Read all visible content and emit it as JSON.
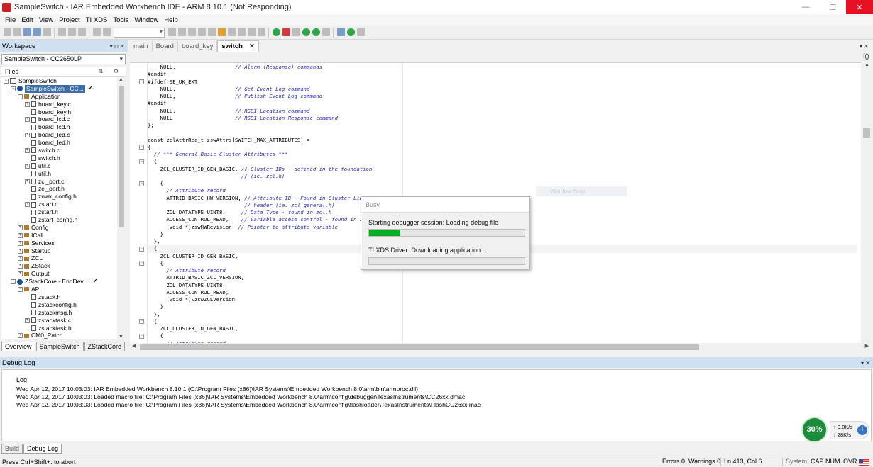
{
  "window": {
    "title": "SampleSwitch - IAR Embedded Workbench IDE - ARM 8.10.1 (Not Responding)",
    "minimize": "—",
    "maximize": "☐",
    "close": "✕"
  },
  "menu": [
    "File",
    "Edit",
    "View",
    "Project",
    "TI XDS",
    "Tools",
    "Window",
    "Help"
  ],
  "workspace": {
    "title": "Workspace",
    "controls": "▾ ⊓ ✕",
    "configuration": "SampleSwitch - CC2650LP",
    "files_label": "Files",
    "tree": [
      {
        "label": "SampleSwitch",
        "indent": 0,
        "exp": "⊟",
        "icon": "ws"
      },
      {
        "label": "SampleSwitch - CC...",
        "indent": 1,
        "exp": "⊟",
        "icon": "proj",
        "selected": true,
        "check": "✔"
      },
      {
        "label": "Application",
        "indent": 2,
        "exp": "⊟",
        "icon": "folder"
      },
      {
        "label": "board_key.c",
        "indent": 3,
        "exp": "⊞",
        "icon": "file"
      },
      {
        "label": "board_key.h",
        "indent": 3,
        "exp": "",
        "icon": "file"
      },
      {
        "label": "board_lcd.c",
        "indent": 3,
        "exp": "⊞",
        "icon": "file"
      },
      {
        "label": "board_lcd.h",
        "indent": 3,
        "exp": "",
        "icon": "file"
      },
      {
        "label": "board_led.c",
        "indent": 3,
        "exp": "⊞",
        "icon": "file"
      },
      {
        "label": "board_led.h",
        "indent": 3,
        "exp": "",
        "icon": "file"
      },
      {
        "label": "switch.c",
        "indent": 3,
        "exp": "⊞",
        "icon": "file"
      },
      {
        "label": "switch.h",
        "indent": 3,
        "exp": "",
        "icon": "file"
      },
      {
        "label": "util.c",
        "indent": 3,
        "exp": "⊞",
        "icon": "file"
      },
      {
        "label": "util.h",
        "indent": 3,
        "exp": "",
        "icon": "file"
      },
      {
        "label": "zcl_port.c",
        "indent": 3,
        "exp": "⊞",
        "icon": "file"
      },
      {
        "label": "zcl_port.h",
        "indent": 3,
        "exp": "",
        "icon": "file"
      },
      {
        "label": "znwk_config.h",
        "indent": 3,
        "exp": "",
        "icon": "file"
      },
      {
        "label": "zstart.c",
        "indent": 3,
        "exp": "⊞",
        "icon": "file"
      },
      {
        "label": "zstart.h",
        "indent": 3,
        "exp": "",
        "icon": "file"
      },
      {
        "label": "zstart_config.h",
        "indent": 3,
        "exp": "",
        "icon": "file"
      },
      {
        "label": "Config",
        "indent": 2,
        "exp": "⊞",
        "icon": "folder"
      },
      {
        "label": "ICall",
        "indent": 2,
        "exp": "⊞",
        "icon": "folder"
      },
      {
        "label": "Services",
        "indent": 2,
        "exp": "⊞",
        "icon": "folder"
      },
      {
        "label": "Startup",
        "indent": 2,
        "exp": "⊞",
        "icon": "folder"
      },
      {
        "label": "ZCL",
        "indent": 2,
        "exp": "⊞",
        "icon": "folder"
      },
      {
        "label": "ZStack",
        "indent": 2,
        "exp": "⊞",
        "icon": "folder"
      },
      {
        "label": "Output",
        "indent": 2,
        "exp": "⊞",
        "icon": "folder"
      },
      {
        "label": "ZStackCore - EndDevi...",
        "indent": 1,
        "exp": "⊟",
        "icon": "proj",
        "check": "✔"
      },
      {
        "label": "API",
        "indent": 2,
        "exp": "⊟",
        "icon": "folder"
      },
      {
        "label": "zstack.h",
        "indent": 3,
        "exp": "",
        "icon": "file"
      },
      {
        "label": "zstackconfig.h",
        "indent": 3,
        "exp": "",
        "icon": "file"
      },
      {
        "label": "zstackmsg.h",
        "indent": 3,
        "exp": "",
        "icon": "file"
      },
      {
        "label": "zstacktask.c",
        "indent": 3,
        "exp": "⊞",
        "icon": "file"
      },
      {
        "label": "zstacktask.h",
        "indent": 3,
        "exp": "",
        "icon": "file"
      },
      {
        "label": "CM0_Patch",
        "indent": 2,
        "exp": "⊞",
        "icon": "folder"
      }
    ],
    "tabs": [
      "Overview",
      "SampleSwitch",
      "ZStackCore"
    ]
  },
  "editor": {
    "tabs": [
      "main",
      "Board",
      "board_key",
      "switch"
    ],
    "active_tab": "switch",
    "tab_close": "✕",
    "controls": "▾ ✕",
    "function_button": "f()",
    "lines": [
      {
        "code": "    NULL,                   ",
        "comment": "// Alarm (Response) commands"
      },
      {
        "code": "#endif",
        "comment": ""
      },
      {
        "code": "#ifdef SE_UK_EXT",
        "comment": ""
      },
      {
        "code": "    NULL,                   ",
        "comment": "// Get Event Log command"
      },
      {
        "code": "    NULL,                   ",
        "comment": "// Publish Event Log command"
      },
      {
        "code": "#endif",
        "comment": ""
      },
      {
        "code": "    NULL,                   ",
        "comment": "// RSSI Location command"
      },
      {
        "code": "    NULL                    ",
        "comment": "// RSSI Location Response command"
      },
      {
        "code": "};",
        "comment": ""
      },
      {
        "code": "",
        "comment": ""
      },
      {
        "code": "const zclAttrRec_t zswAttrs[SWITCH_MAX_ATTRIBUTES] =",
        "comment": ""
      },
      {
        "code": "{",
        "comment": ""
      },
      {
        "code": "  ",
        "comment": "// *** General Basic Cluster Attributes ***"
      },
      {
        "code": "  {",
        "comment": ""
      },
      {
        "code": "    ZCL_CLUSTER_ID_GEN_BASIC, ",
        "comment": "// Cluster IDs - defined in the foundation"
      },
      {
        "code": "                              ",
        "comment": "// (ie. zcl.h)"
      },
      {
        "code": "    {",
        "comment": ""
      },
      {
        "code": "      ",
        "comment": "// Attribute record"
      },
      {
        "code": "      ATTRID_BASIC_HW_VERSION, ",
        "comment": "// Attribute ID - Found in Cluster Library"
      },
      {
        "code": "                               ",
        "comment": "// header (ie. zcl_general.h)"
      },
      {
        "code": "      ZCL_DATATYPE_UINT8,     ",
        "comment": "// Data Type - found in zcl.h"
      },
      {
        "code": "      ACCESS_CONTROL_READ,    ",
        "comment": "// Variable access control - found in zcl.h"
      },
      {
        "code": "      (void *)zswHWRevision  ",
        "comment": "// Pointer to attribute variable"
      },
      {
        "code": "    }",
        "comment": ""
      },
      {
        "code": "  },",
        "comment": ""
      },
      {
        "code": "  {",
        "comment": "",
        "highlight": true
      },
      {
        "code": "    ZCL_CLUSTER_ID_GEN_BASIC,",
        "comment": ""
      },
      {
        "code": "    {",
        "comment": ""
      },
      {
        "code": "      ",
        "comment": "// Attribute record"
      },
      {
        "code": "      ATTRID_BASIC_ZCL_VERSION,",
        "comment": ""
      },
      {
        "code": "      ZCL_DATATYPE_UINT8,",
        "comment": ""
      },
      {
        "code": "      ACCESS_CONTROL_READ,",
        "comment": ""
      },
      {
        "code": "      (void *)&zswZCLVersion",
        "comment": ""
      },
      {
        "code": "    }",
        "comment": ""
      },
      {
        "code": "  },",
        "comment": ""
      },
      {
        "code": "  {",
        "comment": ""
      },
      {
        "code": "    ZCL_CLUSTER_ID_GEN_BASIC,",
        "comment": ""
      },
      {
        "code": "    {",
        "comment": ""
      },
      {
        "code": "      ",
        "comment": "// Attribute record"
      }
    ]
  },
  "window_snip": "Window Snip",
  "busy_dialog": {
    "title": "Busy",
    "message1": "Starting debugger session: Loading debug file",
    "progress1": 0.2,
    "message2": "TI XDS Driver: Downloading application ...",
    "progress2": 0.0,
    "progress_color": "#06b025"
  },
  "debug_log": {
    "title": "Debug Log",
    "controls": "▾ ✕",
    "column": "Log",
    "lines": [
      "Wed Apr 12, 2017 10:03:03: IAR Embedded Workbench 8.10.1 (C:\\Program Files (x86)\\IAR Systems\\Embedded Workbench 8.0\\arm\\bin\\armproc.dll)",
      "Wed Apr 12, 2017 10:03:03: Loaded macro file: C:\\Program Files (x86)\\IAR Systems\\Embedded Workbench 8.0\\arm\\config\\debugger\\TexasInstruments\\CC26xx.dmac",
      "Wed Apr 12, 2017 10:03:03: Loaded macro file: C:\\Program Files (x86)\\IAR Systems\\Embedded Workbench 8.0\\arm\\config\\flashloader\\TexasInstruments\\FlashCC26xx.mac"
    ],
    "tabs": [
      "Build",
      "Debug Log"
    ],
    "active_tab": "Debug Log"
  },
  "net_monitor": {
    "percent": "30%",
    "up_rate": "0.8K/s",
    "down_rate": "28K/s",
    "up_arrow": "↑",
    "down_arrow": "↓",
    "plus": "+"
  },
  "statusbar": {
    "hint": "Press Ctrl+Shift+. to abort",
    "errors": "Errors 0, Warnings 0",
    "position": "Ln 413, Col 6",
    "system": "System",
    "cap": "CAP",
    "num": "NUM",
    "ovr": "OVR"
  },
  "colors": {
    "panel_header": "#cfe0f3",
    "selection": "#3a6ea5",
    "comment": "#2a2ad0",
    "close_button": "#e81123"
  }
}
